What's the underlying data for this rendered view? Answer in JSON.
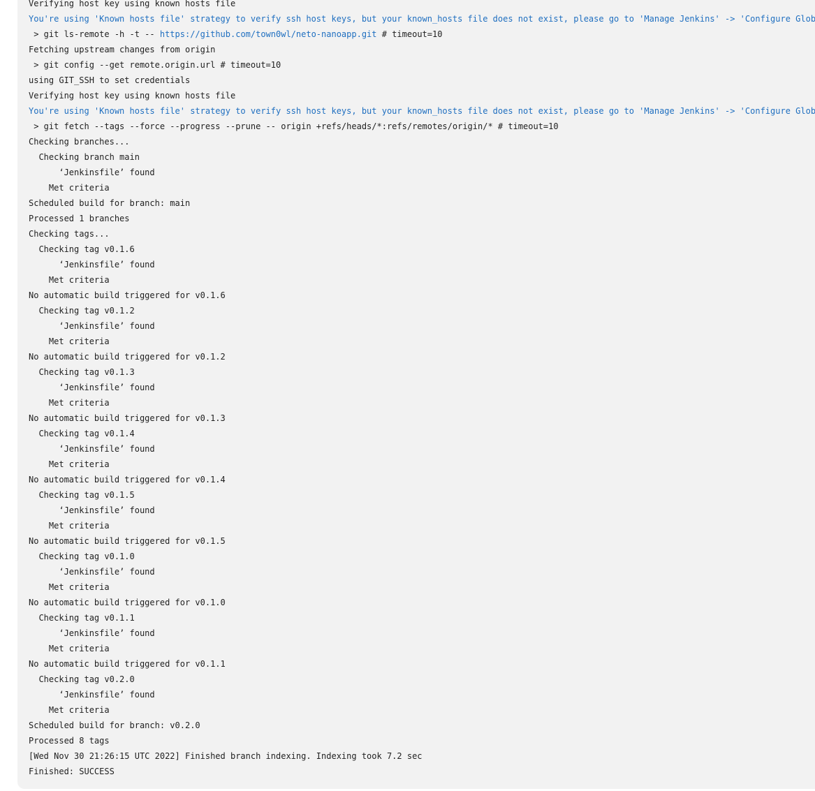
{
  "console": {
    "lines": [
      {
        "text": "Verifying host key using known hosts file"
      },
      {
        "text": "You're using 'Known hosts file' strategy to verify ssh host keys, but your known_hosts file does not exist, please go to 'Manage Jenkins' -> 'Configure Global S",
        "type": "warning"
      },
      {
        "prefix": " > git ls-remote -h -t -- ",
        "link": "https://github.com/town0wl/neto-nanoapp.git",
        "suffix": " # timeout=10"
      },
      {
        "text": "Fetching upstream changes from origin"
      },
      {
        "text": " > git config --get remote.origin.url # timeout=10"
      },
      {
        "text": "using GIT_SSH to set credentials"
      },
      {
        "text": "Verifying host key using known hosts file"
      },
      {
        "text": "You're using 'Known hosts file' strategy to verify ssh host keys, but your known_hosts file does not exist, please go to 'Manage Jenkins' -> 'Configure Global S",
        "type": "warning"
      },
      {
        "text": " > git fetch --tags --force --progress --prune -- origin +refs/heads/*:refs/remotes/origin/* # timeout=10"
      },
      {
        "text": "Checking branches..."
      },
      {
        "text": "  Checking branch main"
      },
      {
        "text": "      ‘Jenkinsfile’ found"
      },
      {
        "text": "    Met criteria"
      },
      {
        "text": "Scheduled build for branch: main"
      },
      {
        "text": "Processed 1 branches"
      },
      {
        "text": "Checking tags..."
      },
      {
        "text": "  Checking tag v0.1.6"
      },
      {
        "text": "      ‘Jenkinsfile’ found"
      },
      {
        "text": "    Met criteria"
      },
      {
        "text": "No automatic build triggered for v0.1.6"
      },
      {
        "text": "  Checking tag v0.1.2"
      },
      {
        "text": "      ‘Jenkinsfile’ found"
      },
      {
        "text": "    Met criteria"
      },
      {
        "text": "No automatic build triggered for v0.1.2"
      },
      {
        "text": "  Checking tag v0.1.3"
      },
      {
        "text": "      ‘Jenkinsfile’ found"
      },
      {
        "text": "    Met criteria"
      },
      {
        "text": "No automatic build triggered for v0.1.3"
      },
      {
        "text": "  Checking tag v0.1.4"
      },
      {
        "text": "      ‘Jenkinsfile’ found"
      },
      {
        "text": "    Met criteria"
      },
      {
        "text": "No automatic build triggered for v0.1.4"
      },
      {
        "text": "  Checking tag v0.1.5"
      },
      {
        "text": "      ‘Jenkinsfile’ found"
      },
      {
        "text": "    Met criteria"
      },
      {
        "text": "No automatic build triggered for v0.1.5"
      },
      {
        "text": "  Checking tag v0.1.0"
      },
      {
        "text": "      ‘Jenkinsfile’ found"
      },
      {
        "text": "    Met criteria"
      },
      {
        "text": "No automatic build triggered for v0.1.0"
      },
      {
        "text": "  Checking tag v0.1.1"
      },
      {
        "text": "      ‘Jenkinsfile’ found"
      },
      {
        "text": "    Met criteria"
      },
      {
        "text": "No automatic build triggered for v0.1.1"
      },
      {
        "text": "  Checking tag v0.2.0"
      },
      {
        "text": "      ‘Jenkinsfile’ found"
      },
      {
        "text": "    Met criteria"
      },
      {
        "text": "Scheduled build for branch: v0.2.0"
      },
      {
        "text": "Processed 8 tags"
      },
      {
        "text": "[Wed Nov 30 21:26:15 UTC 2022] Finished branch indexing. Indexing took 7.2 sec"
      },
      {
        "text": "Finished: SUCCESS"
      }
    ]
  },
  "colors": {
    "panel_background": "#f2f2f2",
    "text": "#1f1f1f",
    "warning_text": "#1f6fc0",
    "link": "#1f6fc0"
  }
}
